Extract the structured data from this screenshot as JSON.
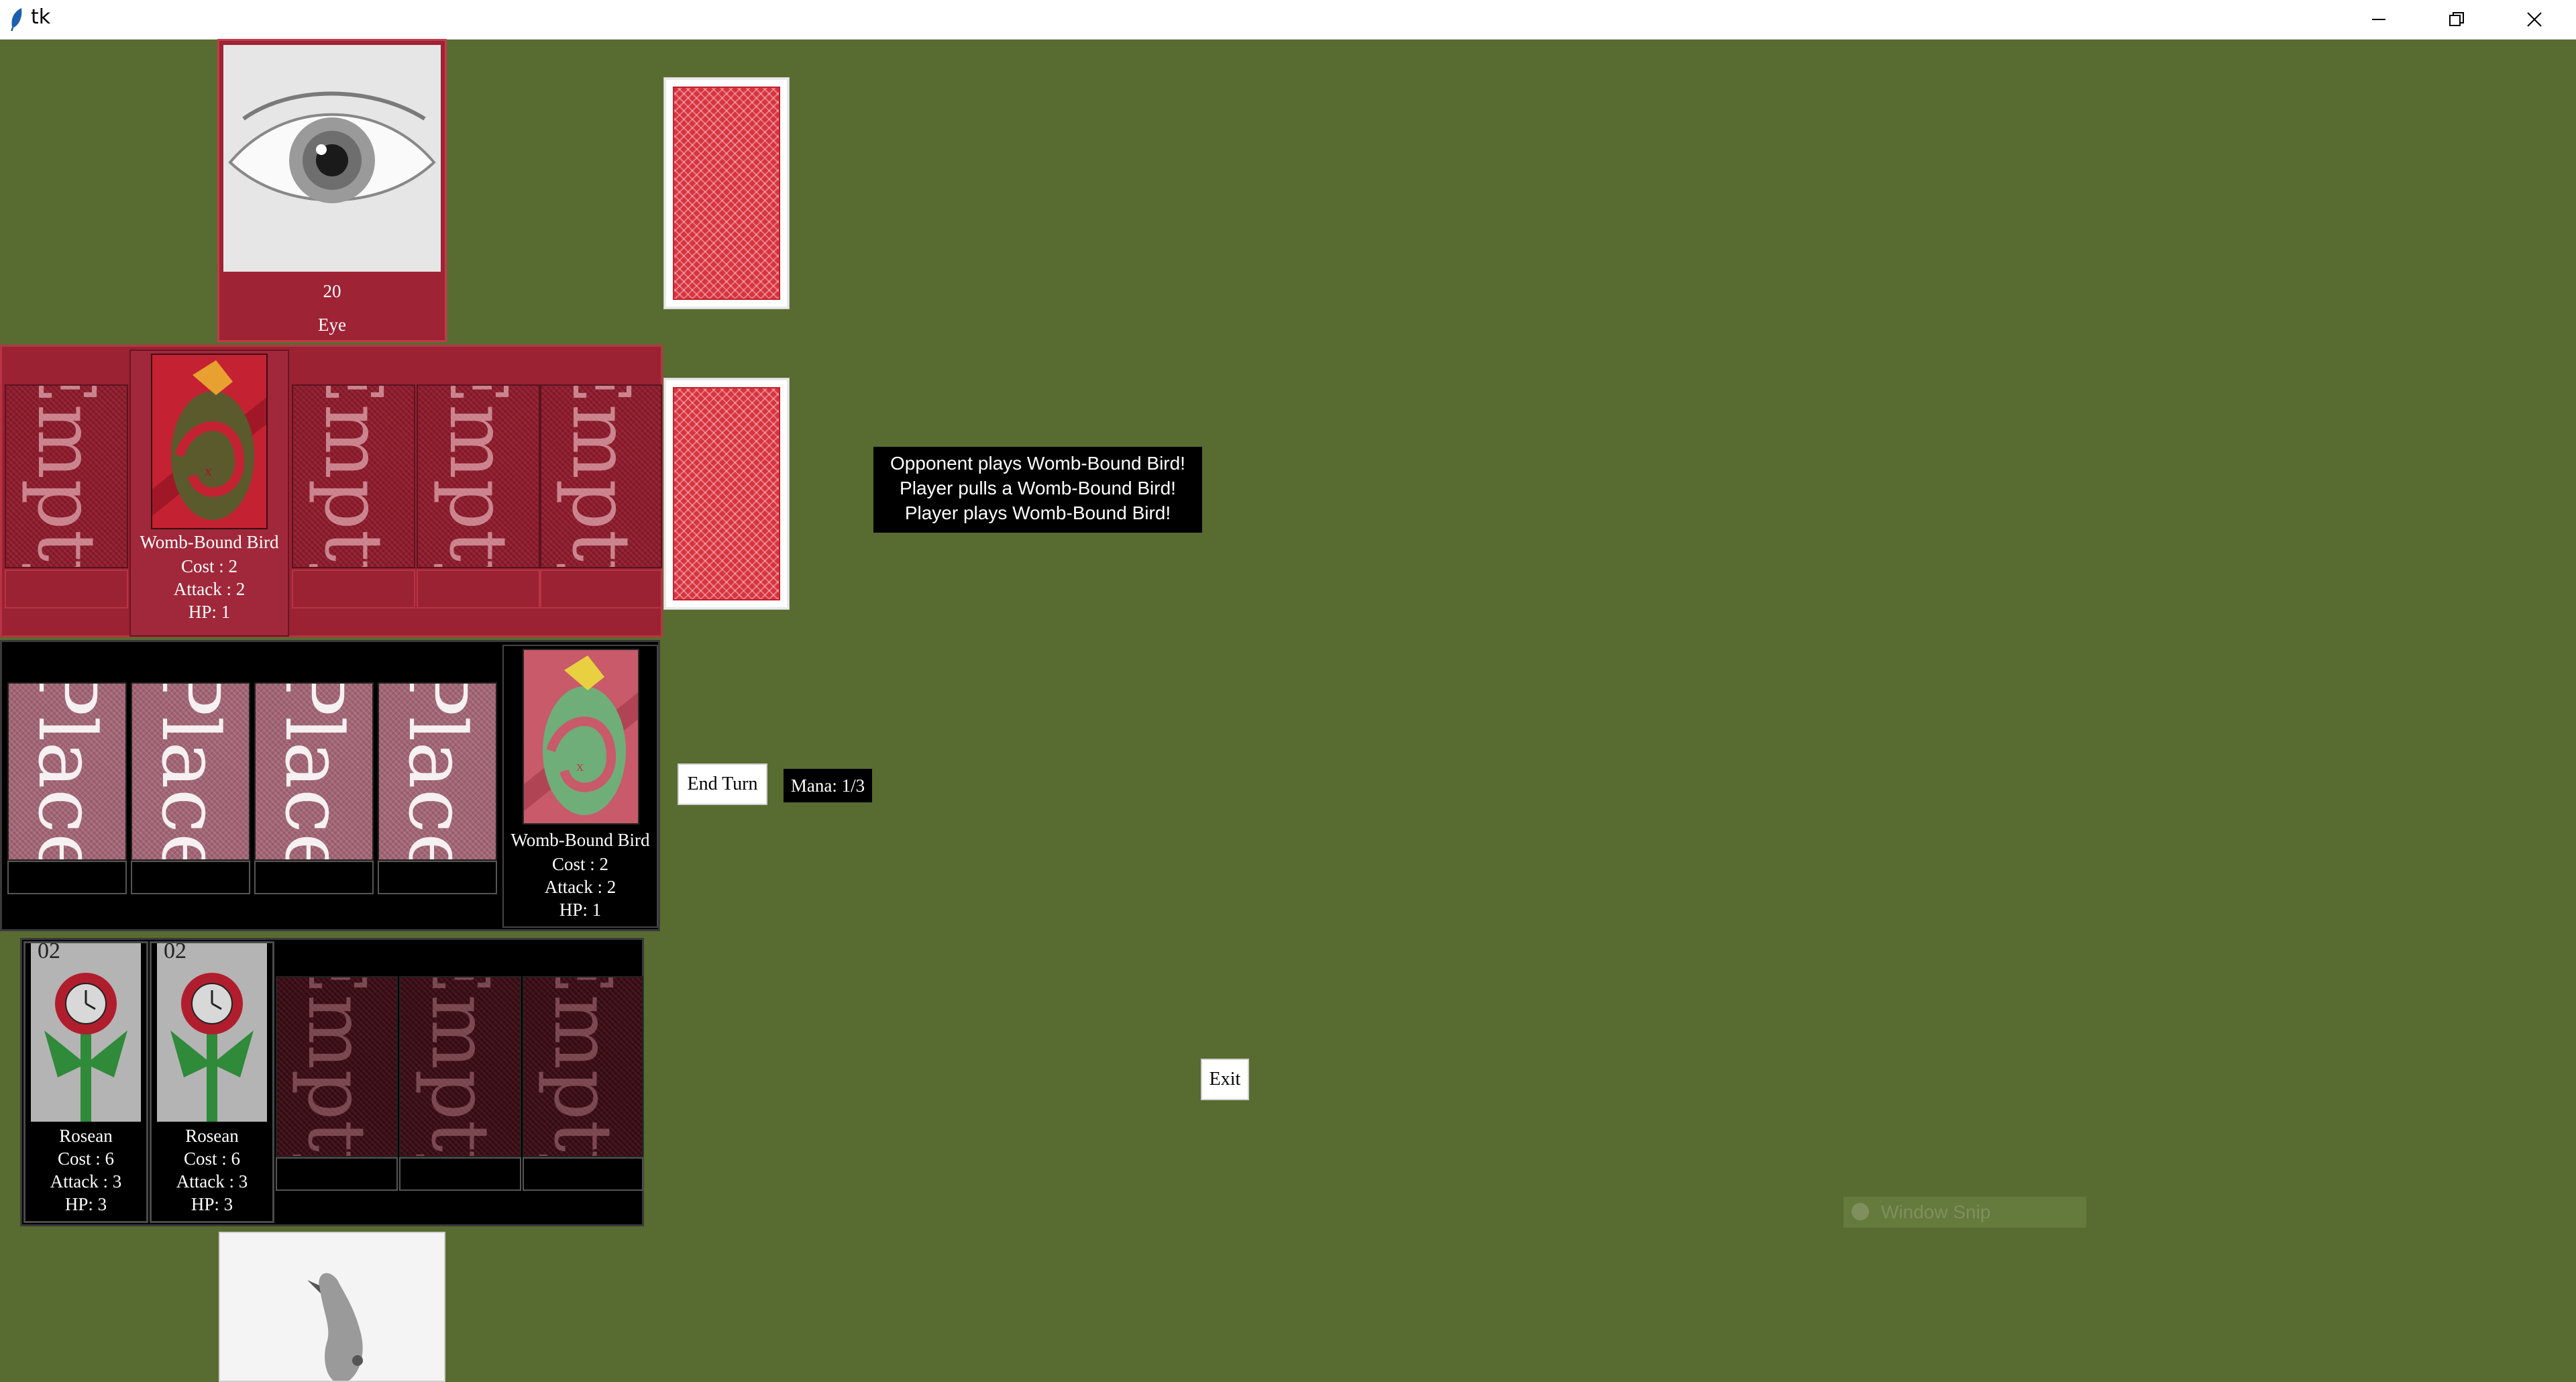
{
  "window": {
    "title": "tk",
    "minimize_icon": "minimize-icon",
    "restore_icon": "restore-icon",
    "close_icon": "close-icon"
  },
  "opponent": {
    "portrait_hp": "20",
    "portrait_name": "Eye",
    "field": {
      "empty_label": "Empty",
      "played_card": {
        "name": "Womb-Bound Bird",
        "cost": "Cost : 2",
        "attack": "Attack : 2",
        "hp": "HP: 1"
      }
    }
  },
  "player": {
    "field": {
      "place_label": "Place",
      "pending_card": {
        "name": "Womb-Bound Bird",
        "cost": "Cost : 2",
        "attack": "Attack : 2",
        "hp": "HP: 1"
      }
    },
    "hand": {
      "cards": [
        {
          "corner": "02",
          "name": "Rosean",
          "cost": "Cost : 6",
          "attack": "Attack : 3",
          "hp": "HP: 3"
        },
        {
          "corner": "02",
          "name": "Rosean",
          "cost": "Cost : 6",
          "attack": "Attack : 3",
          "hp": "HP: 3"
        }
      ],
      "empty_label": "Empty"
    }
  },
  "controls": {
    "end_turn": "End Turn",
    "mana": "Mana: 1/3",
    "exit": "Exit"
  },
  "log": {
    "lines": [
      "Opponent plays Womb-Bound Bird!",
      "Player pulls a Womb-Bound Bird!",
      "Player plays Womb-Bound Bird!"
    ]
  },
  "overlay": {
    "window_snip": "Window Snip"
  },
  "colors": {
    "background": "#586b31",
    "opponent_zone": "#9a2232",
    "player_zone": "#000000",
    "card_back": "#d8333f"
  }
}
